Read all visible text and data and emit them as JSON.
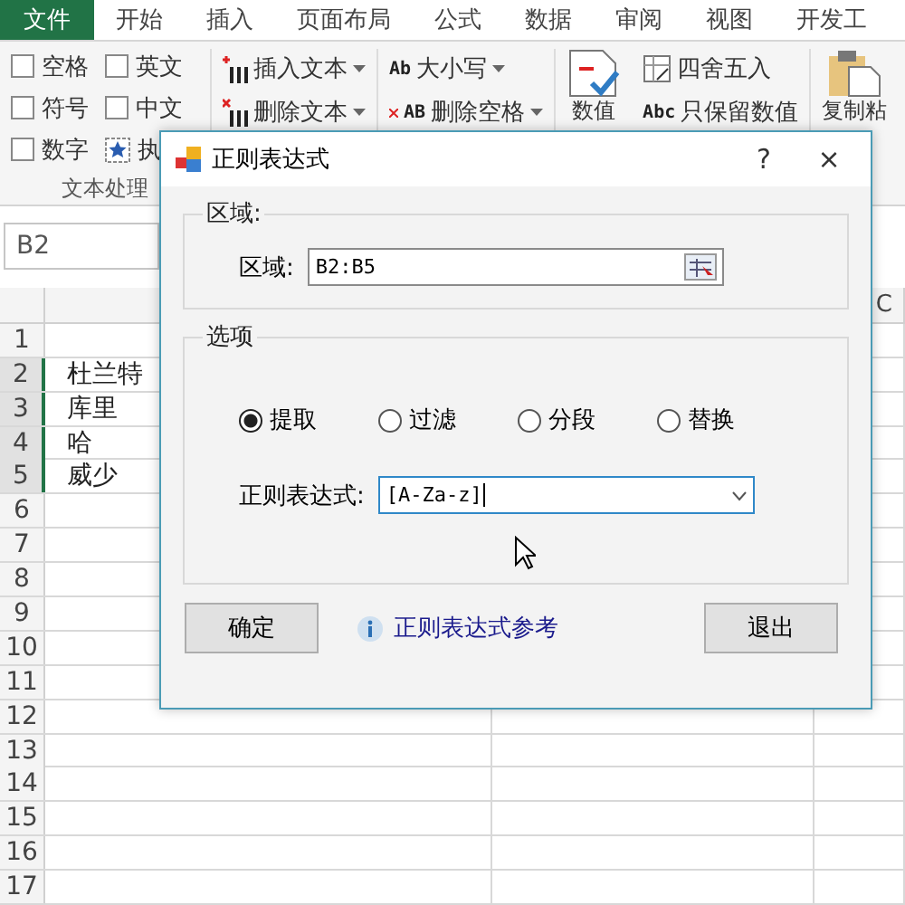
{
  "menu_tabs": [
    {
      "label": "文件",
      "selected": true
    },
    {
      "label": "开始",
      "selected": false
    },
    {
      "label": "插入",
      "selected": false
    },
    {
      "label": "页面布局",
      "selected": false
    },
    {
      "label": "公式",
      "selected": false
    },
    {
      "label": "数据",
      "selected": false
    },
    {
      "label": "审阅",
      "selected": false
    },
    {
      "label": "视图",
      "selected": false
    },
    {
      "label": "开发工",
      "selected": false
    }
  ],
  "ribbon": {
    "checkboxes": [
      {
        "label": "空格",
        "checked": false
      },
      {
        "label": "英文",
        "checked": false
      },
      {
        "label": "符号",
        "checked": false
      },
      {
        "label": "中文",
        "checked": false
      },
      {
        "label": "数字",
        "checked": false
      }
    ],
    "run_button": "执",
    "group_label": "文本处理",
    "text_buttons": [
      {
        "label": "插入文本",
        "kind": "insert"
      },
      {
        "label": "删除文本",
        "kind": "delete"
      }
    ],
    "case_buttons": [
      {
        "glyph": "Ab",
        "label": "大小写",
        "kind": "case"
      },
      {
        "glyph": "AB",
        "label": "删除空格",
        "kind": "space"
      }
    ],
    "value_button": "数值",
    "number_buttons": [
      {
        "label": "四舍五入",
        "kind": "round"
      },
      {
        "glyph": "Abc",
        "label": "只保留数值",
        "kind": "keep"
      }
    ],
    "paste_button": "复制粘"
  },
  "name_box": "B2",
  "column_header": "C",
  "rows": [
    {
      "number": "1",
      "selected": false
    },
    {
      "number": "2",
      "cell": "杜兰特",
      "selected": true
    },
    {
      "number": "3",
      "cell": "库里",
      "selected": true
    },
    {
      "number": "4",
      "cell": "哈",
      "selected": true
    },
    {
      "number": "5",
      "cell": "威少",
      "selected": true
    },
    {
      "number": "6",
      "selected": false
    },
    {
      "number": "7",
      "selected": false
    },
    {
      "number": "8",
      "selected": false
    },
    {
      "number": "9",
      "selected": false
    },
    {
      "number": "10",
      "selected": false
    },
    {
      "number": "11",
      "selected": false
    },
    {
      "number": "12",
      "selected": false
    },
    {
      "number": "13",
      "selected": false
    },
    {
      "number": "14",
      "selected": false
    },
    {
      "number": "15",
      "selected": false
    },
    {
      "number": "16",
      "selected": false
    },
    {
      "number": "17",
      "selected": false
    }
  ],
  "dialog": {
    "title": "正则表达式",
    "help": "?",
    "close": "×",
    "range_group": {
      "legend": "区域:",
      "label": "区域:",
      "value": "B2:B5"
    },
    "options_group": {
      "legend": "选项",
      "radios": [
        {
          "label": "提取",
          "selected": true
        },
        {
          "label": "过滤",
          "selected": false
        },
        {
          "label": "分段",
          "selected": false
        },
        {
          "label": "替换",
          "selected": false
        }
      ],
      "expression_label": "正则表达式:",
      "expression_value": "[A-Za-z]"
    },
    "ok_button": "确定",
    "reference_link": "正则表达式参考",
    "exit_button": "退出"
  }
}
